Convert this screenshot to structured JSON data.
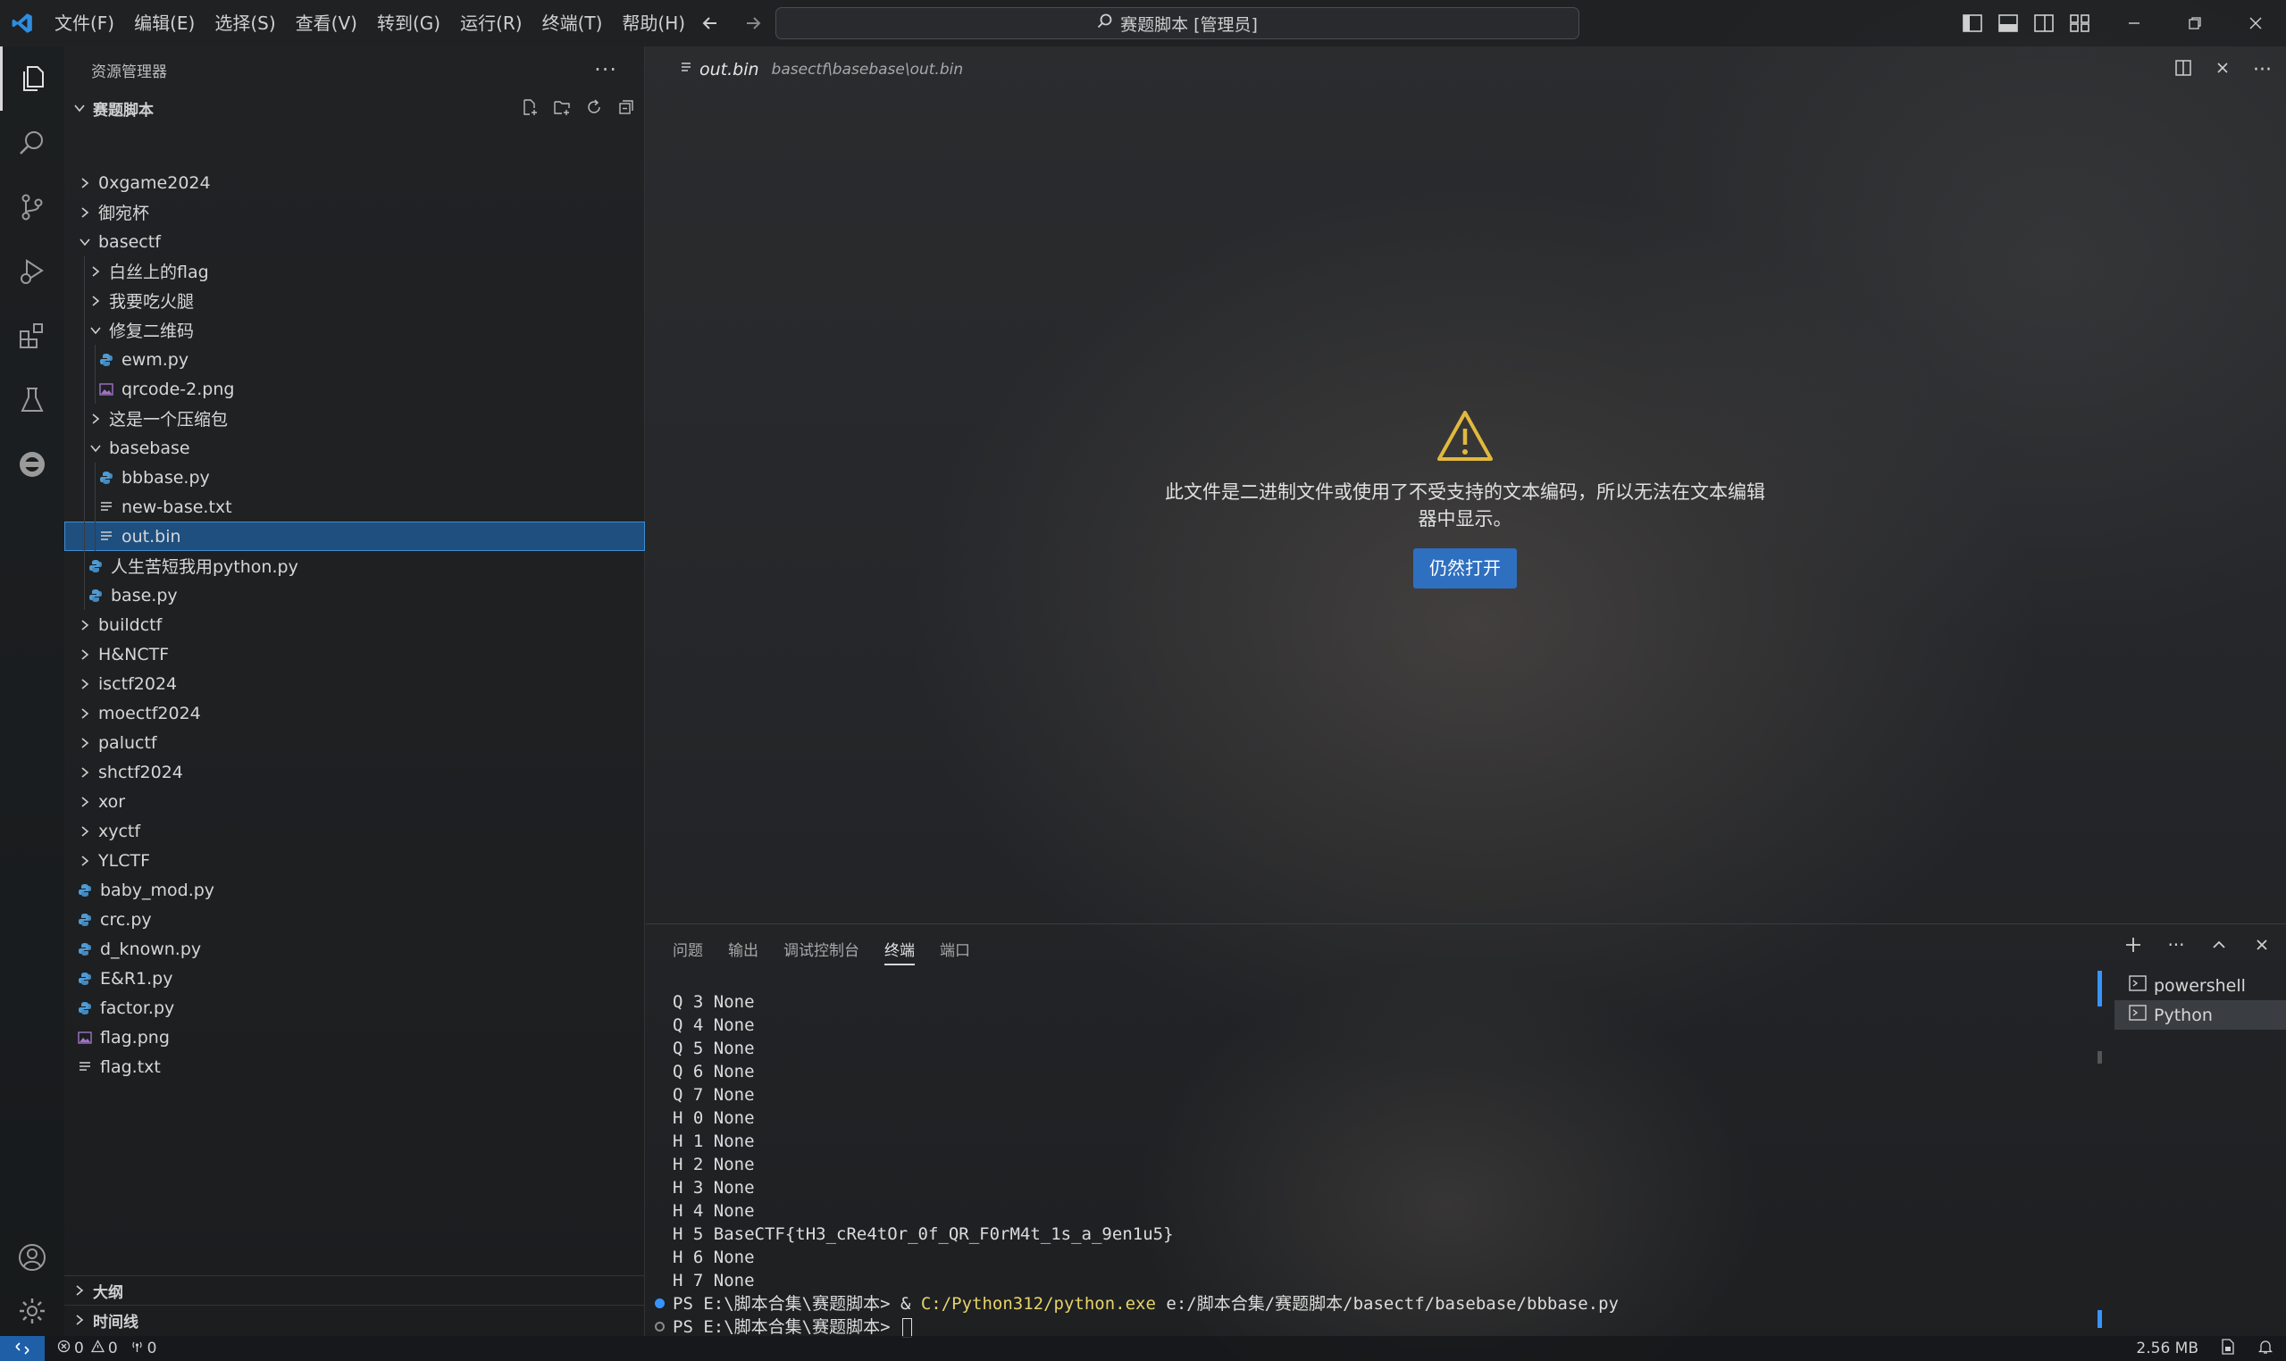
{
  "titlebar": {
    "menus": [
      "文件(F)",
      "编辑(E)",
      "选择(S)",
      "查看(V)",
      "转到(G)",
      "运行(R)",
      "终端(T)",
      "帮助(H)"
    ],
    "command_center": "赛题脚本 [管理员]"
  },
  "sidebar": {
    "title": "资源管理器",
    "folder_name": "赛题脚本",
    "tree": [
      {
        "label": "0xgame2024",
        "type": "folder",
        "expanded": false,
        "depth": 1
      },
      {
        "label": "御宛杯",
        "type": "folder",
        "expanded": false,
        "depth": 1
      },
      {
        "label": "basectf",
        "type": "folder",
        "expanded": true,
        "depth": 1
      },
      {
        "label": "白丝上的flag",
        "type": "folder",
        "expanded": false,
        "depth": 2
      },
      {
        "label": "我要吃火腿",
        "type": "folder",
        "expanded": false,
        "depth": 2
      },
      {
        "label": "修复二维码",
        "type": "folder",
        "expanded": true,
        "depth": 2
      },
      {
        "label": "ewm.py",
        "type": "python",
        "depth": 3
      },
      {
        "label": "qrcode-2.png",
        "type": "image",
        "depth": 3
      },
      {
        "label": "这是一个压缩包",
        "type": "folder",
        "expanded": false,
        "depth": 2
      },
      {
        "label": "basebase",
        "type": "folder",
        "expanded": true,
        "depth": 2
      },
      {
        "label": "bbbase.py",
        "type": "python",
        "depth": 3
      },
      {
        "label": "new-base.txt",
        "type": "text",
        "depth": 3
      },
      {
        "label": "out.bin",
        "type": "text",
        "depth": 3,
        "selected": true
      },
      {
        "label": "人生苦短我用python.py",
        "type": "python",
        "depth": 2
      },
      {
        "label": "base.py",
        "type": "python",
        "depth": 2
      },
      {
        "label": "buildctf",
        "type": "folder",
        "expanded": false,
        "depth": 1
      },
      {
        "label": "H&NCTF",
        "type": "folder",
        "expanded": false,
        "depth": 1
      },
      {
        "label": "isctf2024",
        "type": "folder",
        "expanded": false,
        "depth": 1
      },
      {
        "label": "moectf2024",
        "type": "folder",
        "expanded": false,
        "depth": 1
      },
      {
        "label": "paluctf",
        "type": "folder",
        "expanded": false,
        "depth": 1
      },
      {
        "label": "shctf2024",
        "type": "folder",
        "expanded": false,
        "depth": 1
      },
      {
        "label": "xor",
        "type": "folder",
        "expanded": false,
        "depth": 1
      },
      {
        "label": "xyctf",
        "type": "folder",
        "expanded": false,
        "depth": 1
      },
      {
        "label": "YLCTF",
        "type": "folder",
        "expanded": false,
        "depth": 1
      },
      {
        "label": "baby_mod.py",
        "type": "python",
        "depth": 1
      },
      {
        "label": "crc.py",
        "type": "python",
        "depth": 1
      },
      {
        "label": "d_known.py",
        "type": "python",
        "depth": 1
      },
      {
        "label": "E&R1.py",
        "type": "python",
        "depth": 1
      },
      {
        "label": "factor.py",
        "type": "python",
        "depth": 1
      },
      {
        "label": "flag.png",
        "type": "image",
        "depth": 1
      },
      {
        "label": "flag.txt",
        "type": "text",
        "depth": 1
      }
    ],
    "outline_label": "大纲",
    "timeline_label": "时间线"
  },
  "editor": {
    "tab_name": "out.bin",
    "tab_path": "basectf\\basebase\\out.bin",
    "binary_message": "此文件是二进制文件或使用了不受支持的文本编码，所以无法在文本编辑器中显示。",
    "open_anyway": "仍然打开"
  },
  "panel": {
    "tabs": [
      "问题",
      "输出",
      "调试控制台",
      "终端",
      "端口"
    ],
    "active_tab": "终端",
    "terminal_lines": [
      "Q 3 None",
      "Q 4 None",
      "Q 5 None",
      "Q 6 None",
      "Q 7 None",
      "H 0 None",
      "H 1 None",
      "H 2 None",
      "H 3 None",
      "H 4 None",
      "H 5 BaseCTF{tH3_cRe4tOr_0f_QR_F0rM4t_1s_a_9en1u5}",
      "H 6 None",
      "H 7 None"
    ],
    "prompt1_prefix": "PS E:\\脚本合集\\赛题脚本> & ",
    "prompt1_exe": "C:/Python312/python.exe",
    "prompt1_arg": " e:/脚本合集/赛题脚本/basectf/basebase/bbbase.py",
    "prompt2": "PS E:\\脚本合集\\赛题脚本> ",
    "terminals": [
      "powershell",
      "Python"
    ],
    "active_terminal": "Python"
  },
  "statusbar": {
    "errors": "0",
    "warnings": "0",
    "ports": "0",
    "file_size": "2.56 MB"
  },
  "colors": {
    "accent": "#3794ff",
    "selection": "#1e4f7f",
    "button": "#2e6fc0",
    "warning": "#e2b93d",
    "python_icon": "#4e9bd6",
    "image_icon": "#a074c4"
  }
}
